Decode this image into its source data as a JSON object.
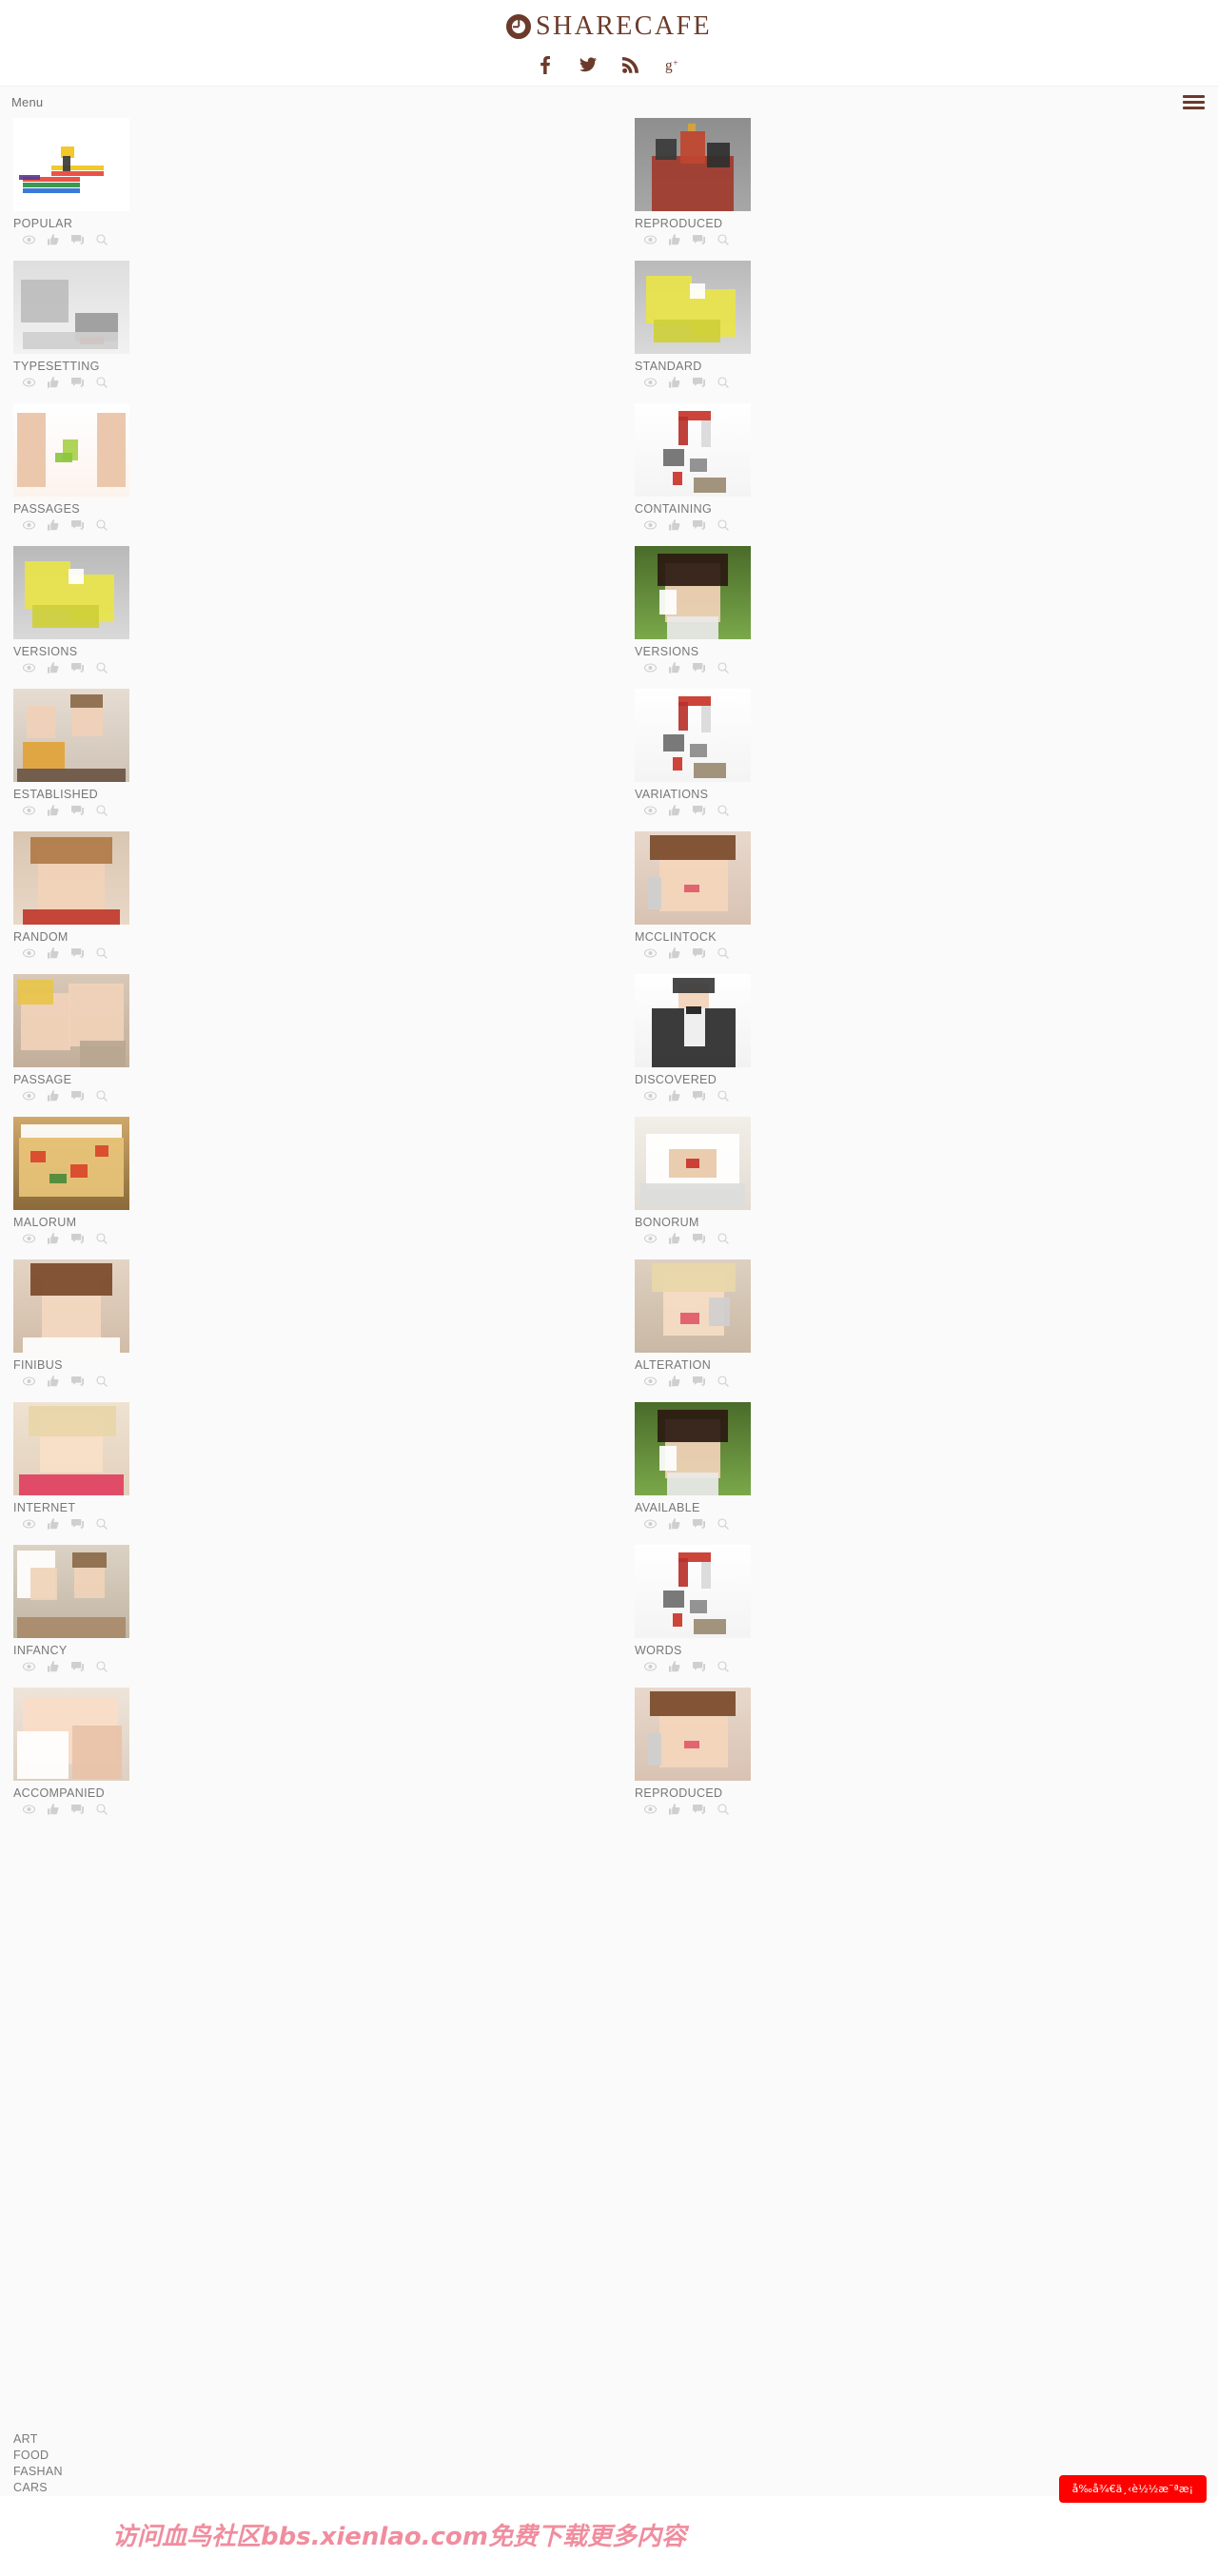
{
  "header": {
    "logo_text": "SHARECAFE",
    "logo_icon": "clock-circle-icon",
    "social": [
      {
        "name": "facebook-icon",
        "label": "f"
      },
      {
        "name": "twitter-icon",
        "label": "twitter"
      },
      {
        "name": "rss-icon",
        "label": "rss"
      },
      {
        "name": "googleplus-icon",
        "label": "g+"
      }
    ]
  },
  "menubar": {
    "label": "Menu",
    "hamburger_icon": "hamburger-menu-icon"
  },
  "meta_icons": [
    {
      "name": "eye-icon",
      "title": "views"
    },
    {
      "name": "thumbs-up-icon",
      "title": "likes"
    },
    {
      "name": "comment-icon",
      "title": "comments"
    },
    {
      "name": "search-icon",
      "title": "zoom"
    }
  ],
  "grid": {
    "left_column": [
      {
        "title": "POPULAR",
        "image": "girl-on-stack-of-books",
        "height": 98
      },
      {
        "title": "TYPESETTING",
        "image": "grey-modern-living-room",
        "height": 98
      },
      {
        "title": "PASSAGES",
        "image": "hands-circling-green-seedling",
        "height": 98
      },
      {
        "title": "VERSIONS",
        "image": "yellow-globe-map-lightbulb",
        "height": 98
      },
      {
        "title": "ESTABLISHED",
        "image": "couple-laughing-at-cafe-table",
        "height": 98
      },
      {
        "title": "RANDOM",
        "image": "smiling-little-girl-portrait",
        "height": 98
      },
      {
        "title": "PASSAGE",
        "image": "child-with-grandparent-cheek",
        "height": 98
      },
      {
        "title": "MALORUM",
        "image": "pizza-with-tomatoes-and-basil",
        "height": 98
      },
      {
        "title": "FINIBUS",
        "image": "young-woman-brown-hair-portrait",
        "height": 98
      },
      {
        "title": "INTERNET",
        "image": "blonde-girl-in-pink-dress",
        "height": 98
      },
      {
        "title": "INFANCY",
        "image": "couple-at-kitchen-window",
        "height": 98
      },
      {
        "title": "ACCOMPANIED",
        "image": "baby-sleeping-closeup",
        "height": 98
      }
    ],
    "right_column": [
      {
        "title": "REPRODUCED",
        "image": "saint-basils-cathedral-moscow",
        "height": 98
      },
      {
        "title": "STANDARD",
        "image": "yellow-globe-map-lightbulb",
        "height": 98
      },
      {
        "title": "CONTAINING",
        "image": "magnet-attracting-office-items",
        "height": 98
      },
      {
        "title": "VERSIONS",
        "image": "woman-on-phone-smiling-outdoors",
        "height": 98
      },
      {
        "title": "VARIATIONS",
        "image": "magnet-attracting-office-items",
        "height": 98
      },
      {
        "title": "MCCLINTOCK",
        "image": "woman-applying-makeup",
        "height": 98
      },
      {
        "title": "DISCOVERED",
        "image": "waiter-in-bowtie-and-vest",
        "height": 98
      },
      {
        "title": "BONORUM",
        "image": "dessert-on-white-plate",
        "height": 98
      },
      {
        "title": "ALTERATION",
        "image": "child-playing-with-makeup",
        "height": 98
      },
      {
        "title": "AVAILABLE",
        "image": "woman-on-phone-smiling-outdoors",
        "height": 98
      },
      {
        "title": "WORDS",
        "image": "magnet-attracting-office-items",
        "height": 98
      },
      {
        "title": "REPRODUCED",
        "image": "woman-applying-makeup",
        "height": 98
      }
    ]
  },
  "footer": {
    "categories": [
      "ART",
      "FOOD",
      "FASHAN",
      "CARS"
    ]
  },
  "overlay": {
    "watermark_text": "访问血鸟社区bbs.xienlao.com免费下载更多内容",
    "badge_text": "å‰å¾€ä¸‹è½½æ¨ªæ¡",
    "badge_color": "#ff0000",
    "watermark_color": "#f08d9e"
  },
  "colors": {
    "brand": "#6b3a2a",
    "page_bg": "#fafafa",
    "text_muted": "#777777",
    "icon_grey": "#cfcfcf"
  }
}
